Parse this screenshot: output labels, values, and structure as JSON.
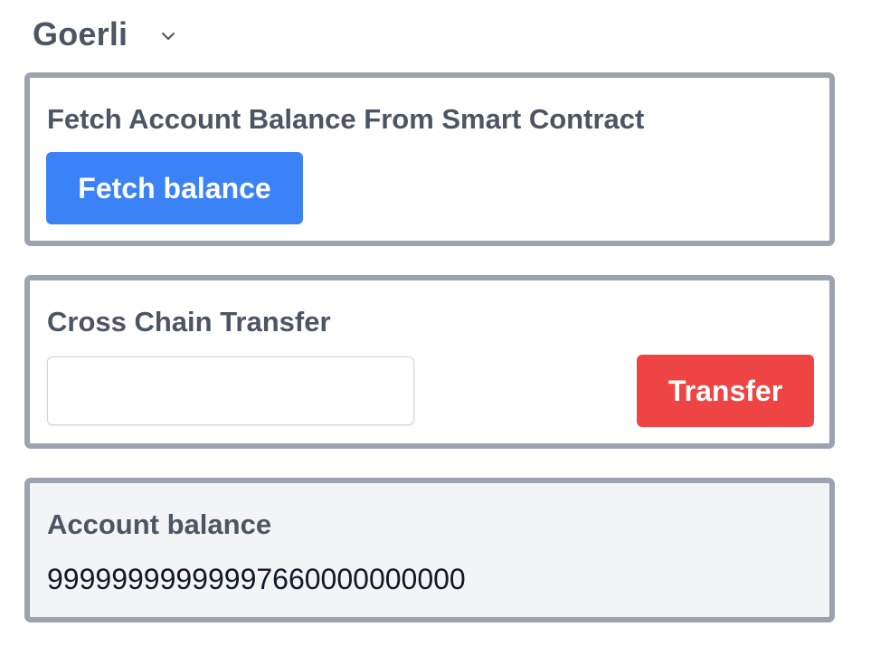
{
  "network": {
    "selected": "Goerli",
    "icon": "chevron-down-icon"
  },
  "fetch_card": {
    "title": "Fetch Account Balance From Smart Contract",
    "button_label": "Fetch balance",
    "button_color": "#3b82f6"
  },
  "transfer_card": {
    "title": "Cross Chain Transfer",
    "input_value": "",
    "input_placeholder": "",
    "button_label": "Transfer",
    "button_color": "#ef4444"
  },
  "balance_card": {
    "title": "Account balance",
    "value": "99999999999997660000000000"
  },
  "colors": {
    "card_border": "#9ca3af",
    "heading_text": "#4b5563",
    "balance_bg": "#f3f4f6"
  }
}
